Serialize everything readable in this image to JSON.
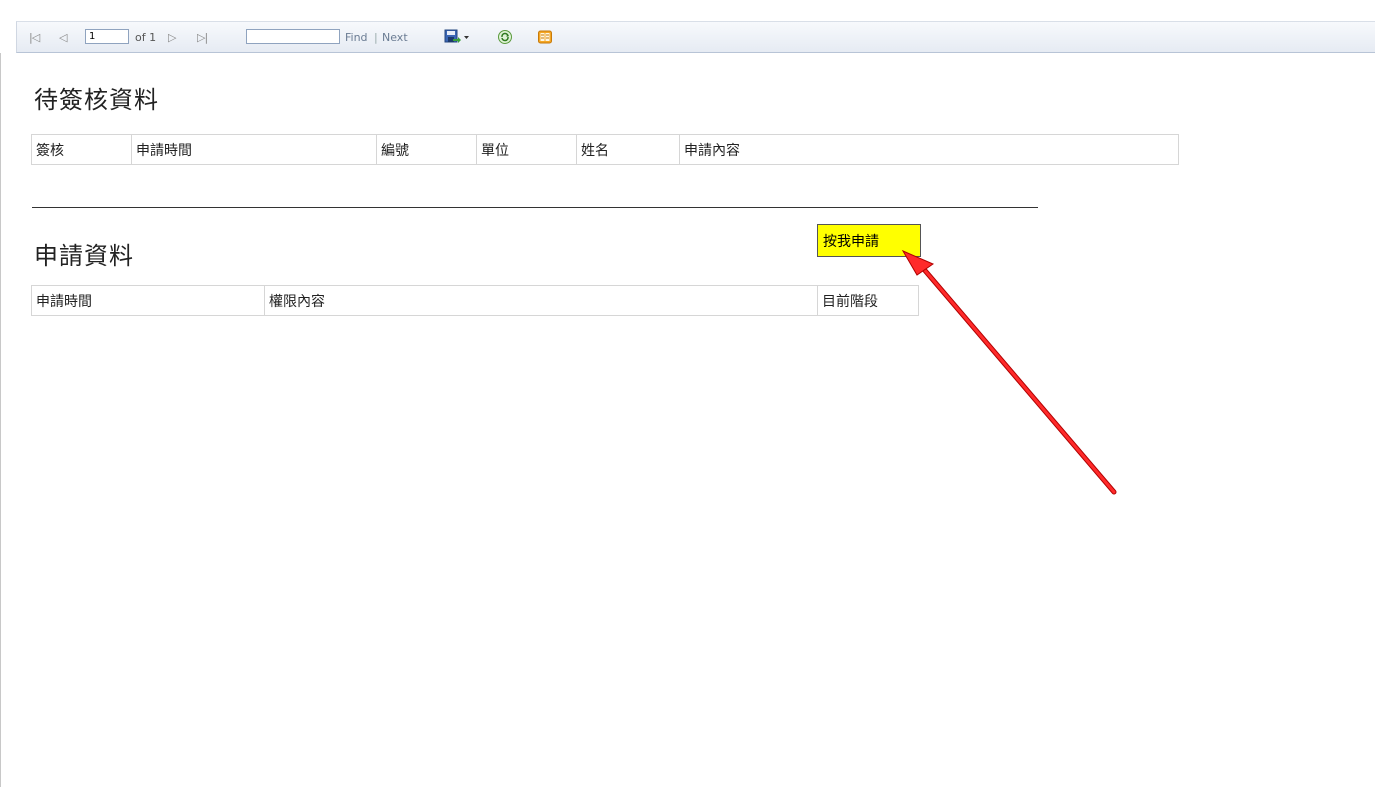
{
  "toolbar": {
    "first_page_icon": "first-page-icon",
    "prev_page_icon": "prev-page-icon",
    "current_page": "1",
    "of_pages": "of 1",
    "next_page_icon": "next-page-icon",
    "last_page_icon": "last-page-icon",
    "find_value": "",
    "find_label": "Find",
    "separator": "|",
    "next_label": "Next",
    "export_icon": "export-save-icon",
    "refresh_icon": "refresh-icon",
    "print_icon": "print-layout-icon"
  },
  "pending_section": {
    "title": "待簽核資料",
    "columns": [
      "簽核",
      "申請時間",
      "編號",
      "單位",
      "姓名",
      "申請內容"
    ]
  },
  "apply_section": {
    "title": "申請資料",
    "apply_button": "按我申請",
    "columns": [
      "申請時間",
      "權限內容",
      "目前階段"
    ]
  },
  "colors": {
    "button_bg": "#ffff00",
    "annotation_arrow": "#e01010"
  }
}
